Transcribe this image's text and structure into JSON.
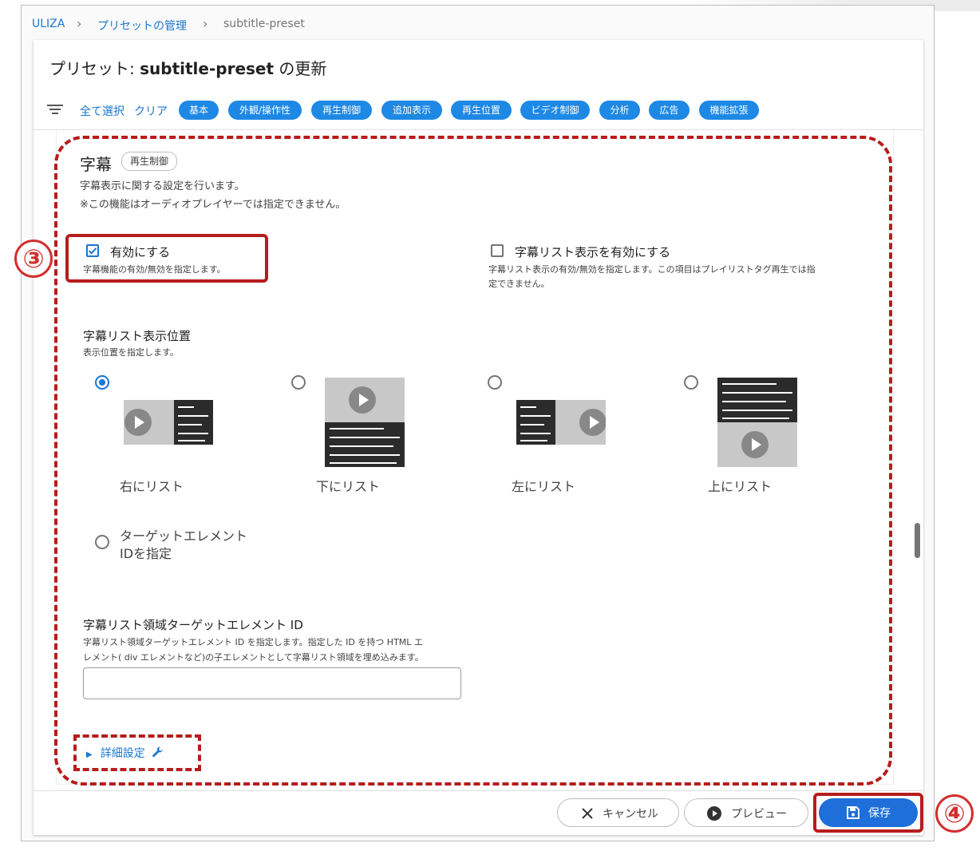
{
  "breadcrumb": {
    "items": [
      "ULIZA",
      "プリセットの管理",
      "subtitle-preset"
    ],
    "separator": "›"
  },
  "page": {
    "title_prefix": "プリセット: ",
    "title_name": "subtitle-preset",
    "title_suffix": " の更新"
  },
  "filter": {
    "select_all": "全て選択",
    "clear": "クリア",
    "chips": [
      "基本",
      "外観/操作性",
      "再生制御",
      "追加表示",
      "再生位置",
      "ビデオ制御",
      "分析",
      "広告",
      "機能拡張"
    ]
  },
  "section": {
    "title": "字幕",
    "badge": "再生制御",
    "desc1": "字幕表示に関する設定を行います。",
    "desc2": "※この機能はオーディオプレイヤーでは指定できません。"
  },
  "enable": {
    "label": "有効にする",
    "help": "字幕機能の有効/無効を指定します。",
    "checked": true
  },
  "list_enable": {
    "label": "字幕リスト表示を有効にする",
    "help1": "字幕リスト表示の有効/無効を指定します。この項目はプレイリストタグ再生では指",
    "help2": "定できません。",
    "checked": false
  },
  "position": {
    "label": "字幕リスト表示位置",
    "help": "表示位置を指定します。",
    "options": [
      "右にリスト",
      "下にリスト",
      "左にリスト",
      "上にリスト"
    ],
    "target_option_line1": "ターゲットエレメント",
    "target_option_line2": "IDを指定",
    "selected": "右にリスト"
  },
  "target_id": {
    "label": "字幕リスト領域ターゲットエレメント ID",
    "help1": "字幕リスト領域ターゲットエレメント ID を指定します。指定した ID を持つ HTML エ",
    "help2": "レメント( div エレメントなど)の子エレメントとして字幕リスト領域を埋め込みます。",
    "value": ""
  },
  "advanced": {
    "label": "詳細設定"
  },
  "footer": {
    "cancel": "キャンセル",
    "preview": "プレビュー",
    "save": "保存"
  },
  "annotations": {
    "marker3": "③",
    "marker4": "④"
  },
  "colors": {
    "primary": "#1976d2",
    "chip": "#1e88e5",
    "annotation": "#b71c1c"
  }
}
